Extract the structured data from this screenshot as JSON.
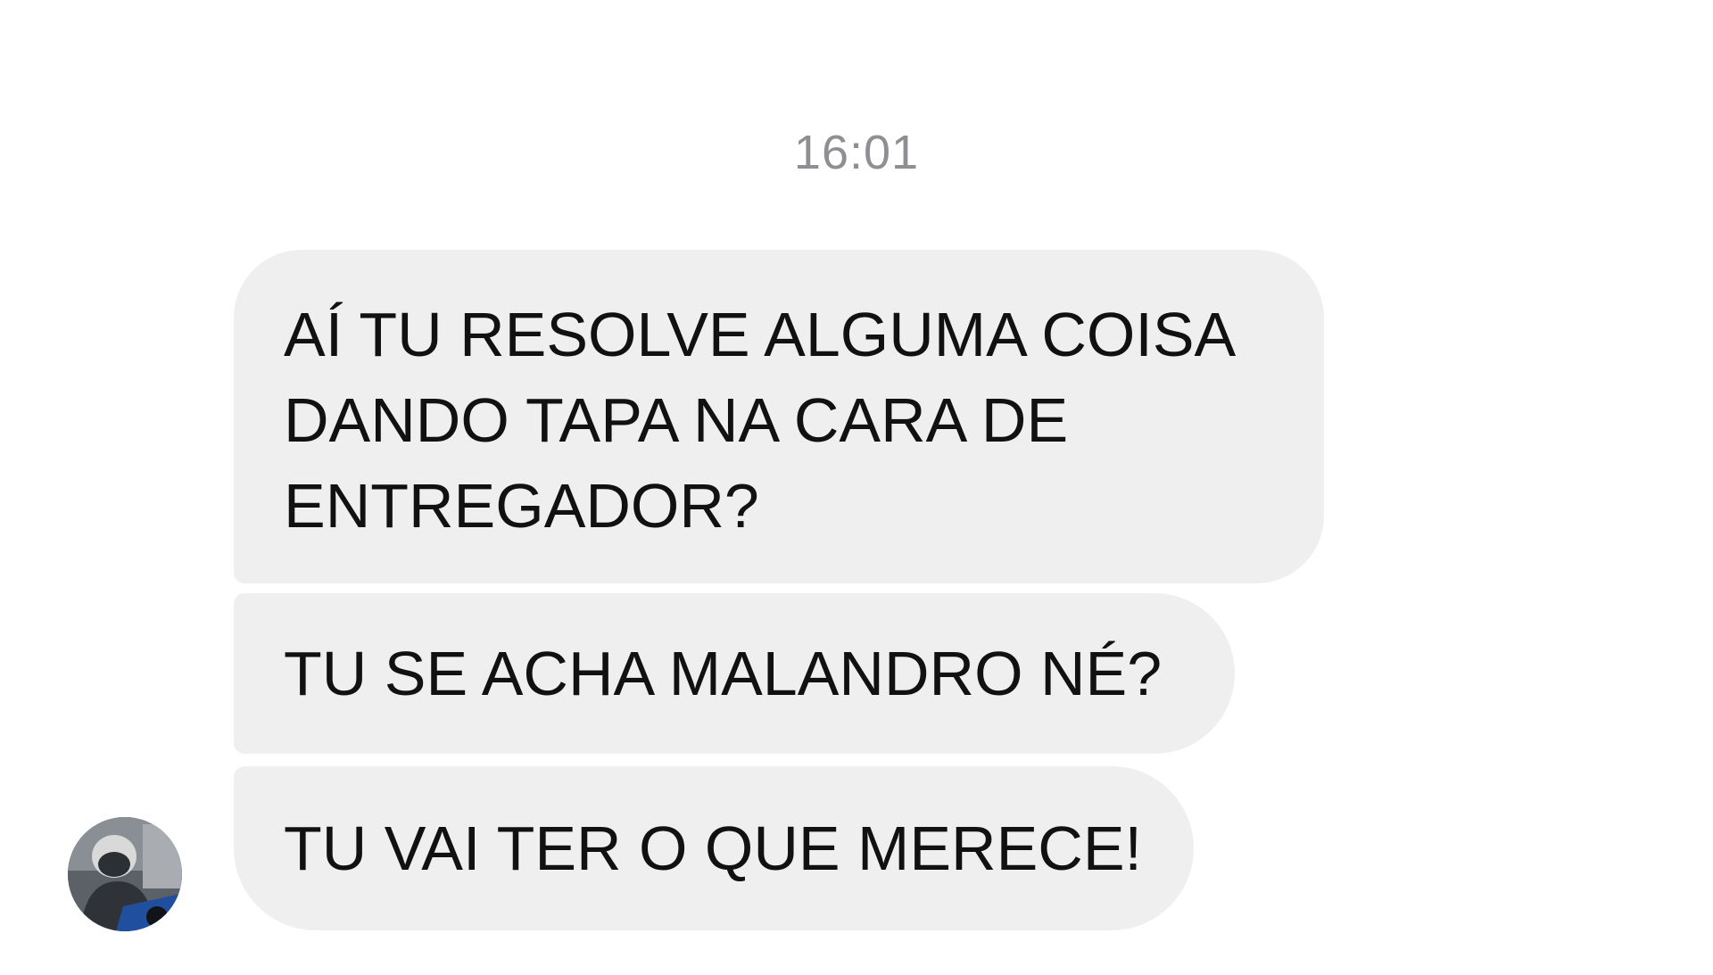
{
  "conversation": {
    "timestamp": "16:01",
    "messages": [
      {
        "text": "AÍ TU RESOLVE ALGUMA COISA\nDANDO TAPA NA CARA DE\nENTREGADOR?"
      },
      {
        "text": "TU SE ACHA MALANDRO NÉ?"
      },
      {
        "text": "TU VAI TER O QUE MERECE!"
      }
    ],
    "bubble_color": "#efefef",
    "timestamp_color": "#8e8e93",
    "sender_avatar": "avatar-photo"
  }
}
